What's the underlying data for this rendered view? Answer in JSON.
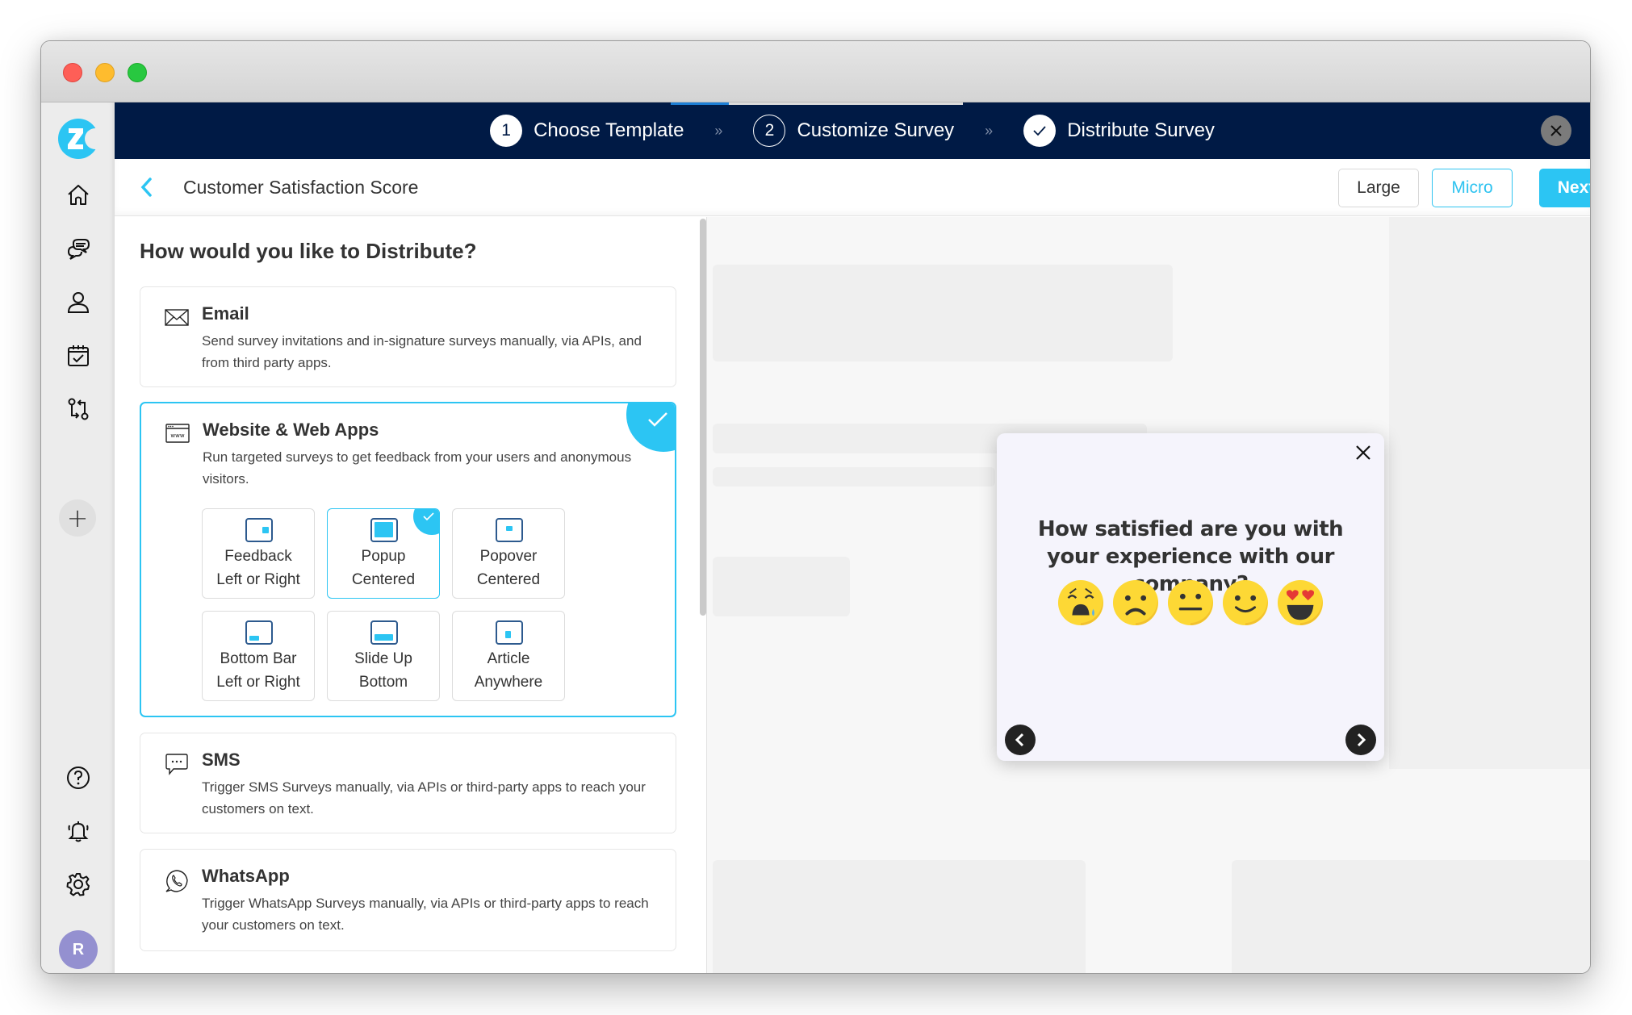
{
  "window": {
    "title": ""
  },
  "sidebar": {
    "logo_letter": "Z",
    "items": [
      {
        "name": "home",
        "icon": "home-icon"
      },
      {
        "name": "conversations",
        "icon": "chat-bubbles-icon"
      },
      {
        "name": "contacts",
        "icon": "user-icon"
      },
      {
        "name": "tasks",
        "icon": "calendar-check-icon"
      },
      {
        "name": "workflows",
        "icon": "workflow-icon"
      }
    ],
    "add_label": "+",
    "bottom_items": [
      {
        "name": "help",
        "icon": "help-icon"
      },
      {
        "name": "notifications",
        "icon": "bell-icon"
      },
      {
        "name": "settings",
        "icon": "gear-icon"
      }
    ],
    "avatar_initial": "R"
  },
  "stepper": {
    "progress_percent": 20,
    "steps": [
      {
        "number": "1",
        "label": "Choose Template",
        "state": "done"
      },
      {
        "number": "2",
        "label": "Customize Survey",
        "state": "current"
      },
      {
        "number": "✓",
        "label": "Distribute Survey",
        "state": "done-check"
      }
    ],
    "separator": "»"
  },
  "header": {
    "title": "Customer Satisfaction Score",
    "buttons": {
      "large": "Large",
      "micro": "Micro",
      "next": "Next"
    }
  },
  "distribute": {
    "heading": "How would you like to Distribute?",
    "channels": [
      {
        "title": "Email",
        "icon": "envelope-icon",
        "description": "Send survey invitations and in-signature surveys manually, via APIs, and from third party apps.",
        "selected": false
      },
      {
        "title": "Website & Web Apps",
        "icon": "browser-www-icon",
        "description": "Run targeted surveys to get feedback from your users and anonymous visitors.",
        "selected": true
      },
      {
        "title": "SMS",
        "icon": "message-bubble-icon",
        "description": "Trigger SMS Surveys manually, via APIs or third-party apps to reach your customers on text.",
        "selected": false
      },
      {
        "title": "WhatsApp",
        "icon": "whatsapp-icon",
        "description": "Trigger WhatsApp Surveys manually, via APIs or third-party apps to reach your customers on text.",
        "selected": false
      }
    ],
    "web_options": [
      {
        "line1": "Feedback",
        "line2": "Left or Right",
        "selected": false
      },
      {
        "line1": "Popup",
        "line2": "Centered",
        "selected": true
      },
      {
        "line1": "Popover",
        "line2": "Centered",
        "selected": false
      },
      {
        "line1": "Bottom Bar",
        "line2": "Left or Right",
        "selected": false
      },
      {
        "line1": "Slide Up",
        "line2": "Bottom",
        "selected": false
      },
      {
        "line1": "Article",
        "line2": "Anywhere",
        "selected": false
      }
    ]
  },
  "preview": {
    "question": "How satisfied are you with your experience with our company?",
    "ratings": [
      "very-dissatisfied",
      "dissatisfied",
      "neutral",
      "satisfied",
      "very-satisfied"
    ]
  },
  "colors": {
    "navy": "#001a45",
    "accent": "#2cc5f3",
    "icon_frame": "#2d5a8e",
    "avatar": "#9490d0"
  }
}
